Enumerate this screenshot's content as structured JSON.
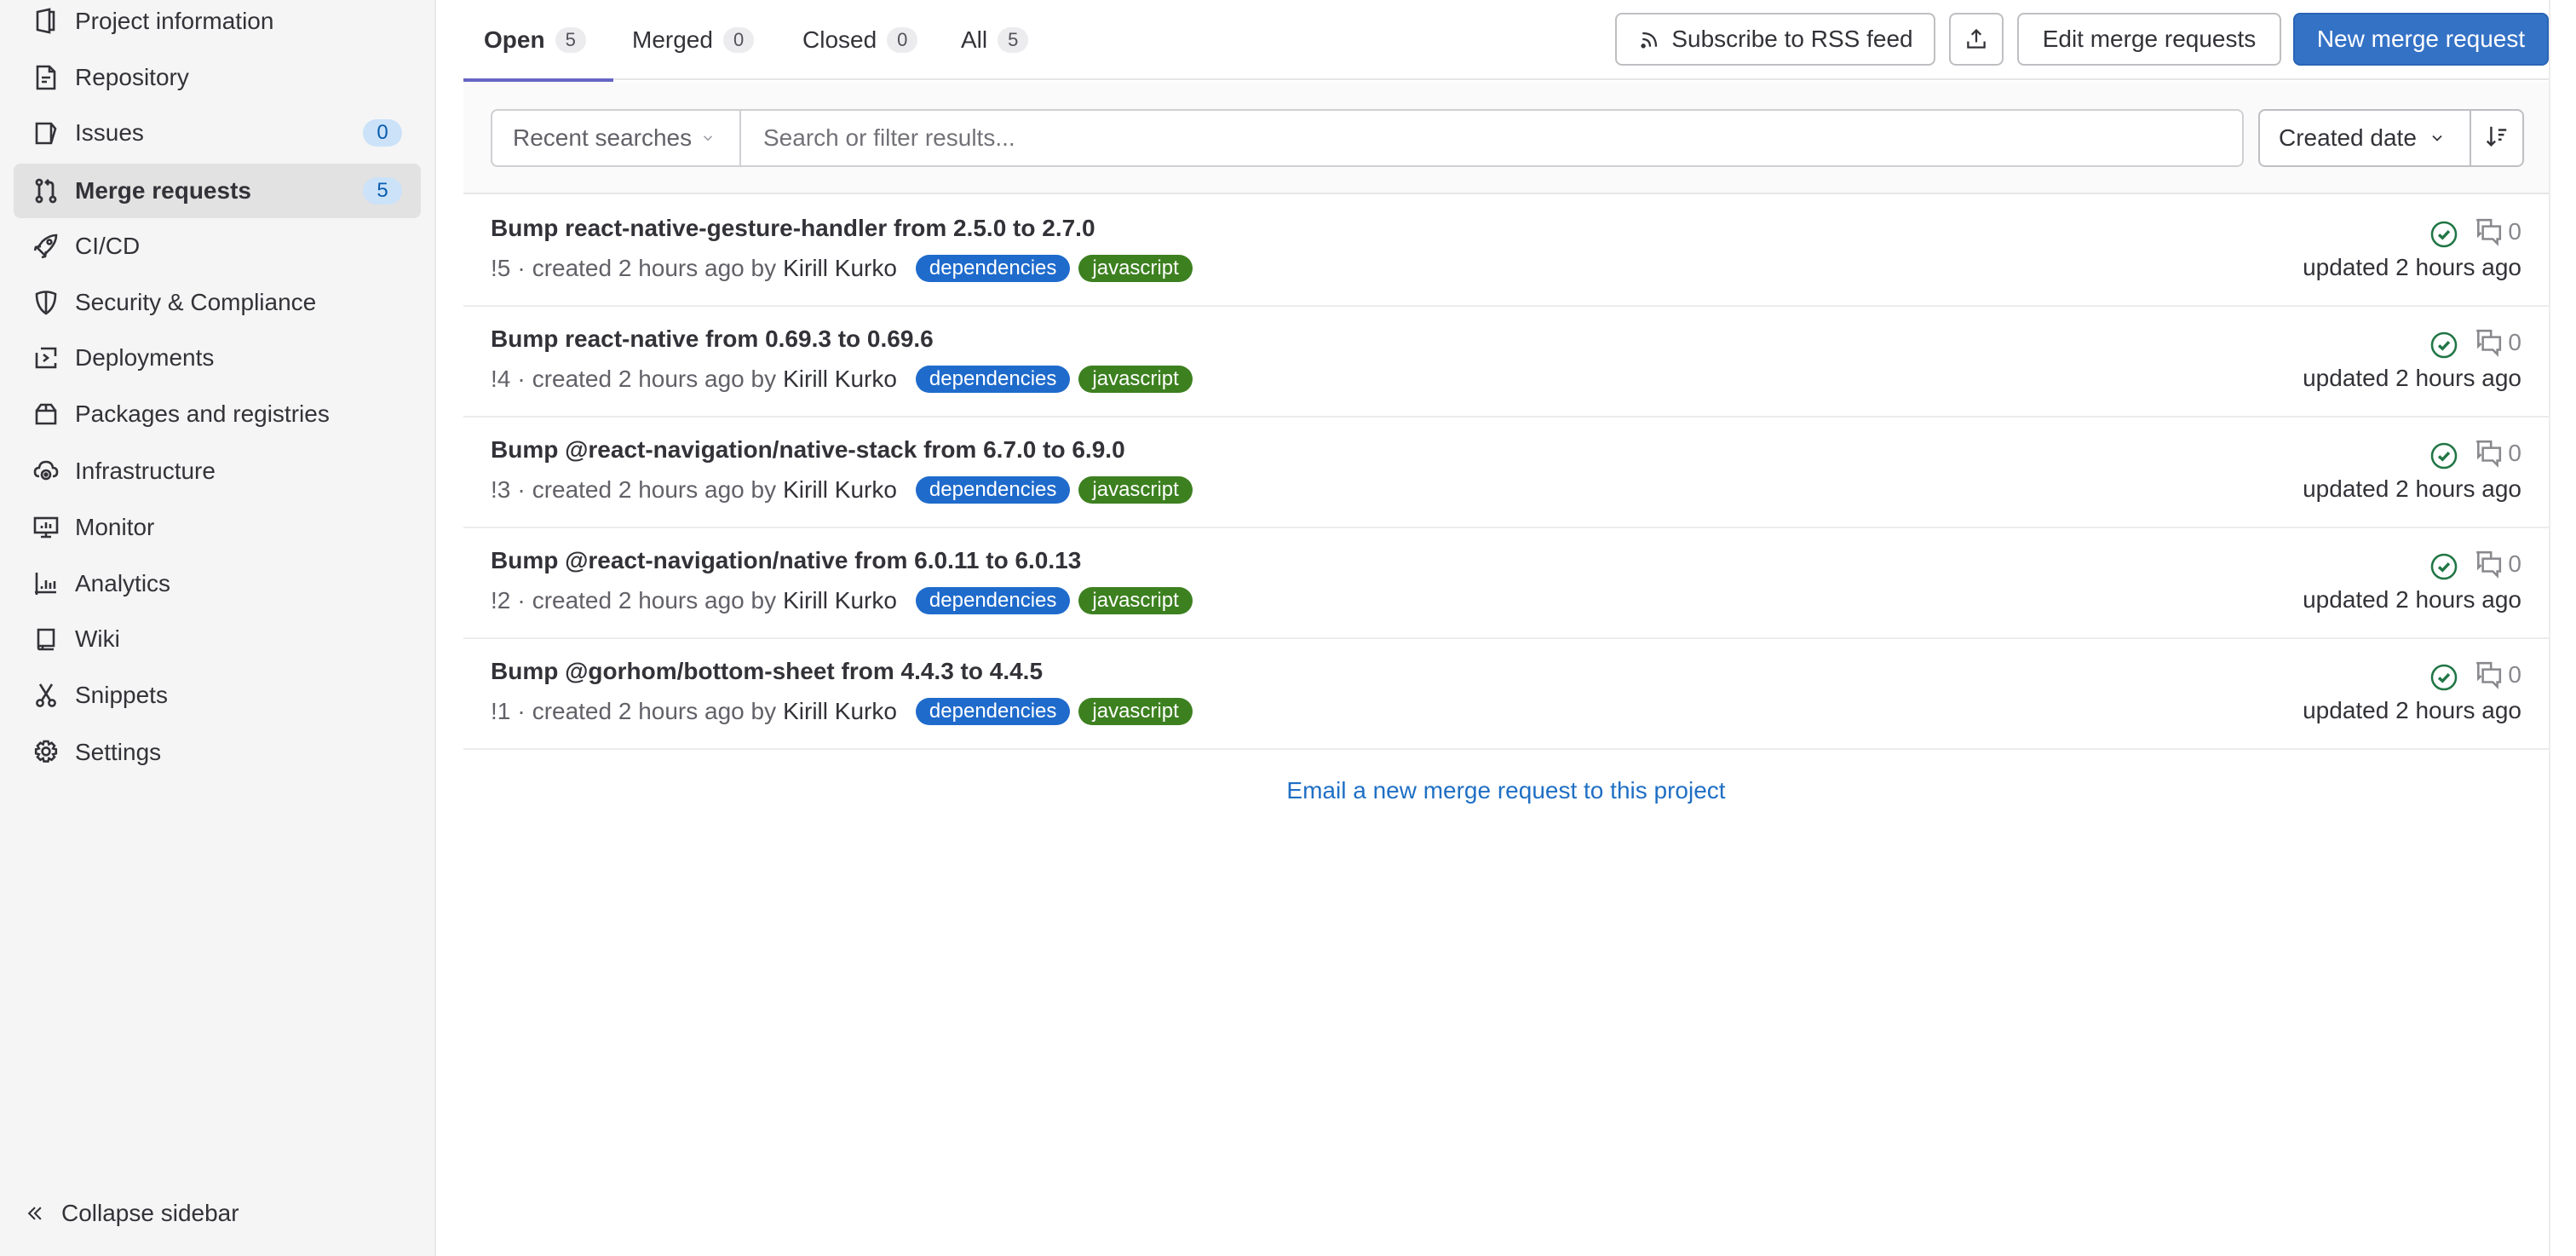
{
  "sidebar": {
    "items": [
      {
        "label": "Project information",
        "icon": "project-info-icon"
      },
      {
        "label": "Repository",
        "icon": "document-icon"
      },
      {
        "label": "Issues",
        "icon": "issues-icon",
        "count": "0"
      },
      {
        "label": "Merge requests",
        "icon": "merge-request-icon",
        "count": "5",
        "active": true
      },
      {
        "label": "CI/CD",
        "icon": "rocket-icon"
      },
      {
        "label": "Security & Compliance",
        "icon": "shield-icon"
      },
      {
        "label": "Deployments",
        "icon": "deployments-icon"
      },
      {
        "label": "Packages and registries",
        "icon": "package-icon"
      },
      {
        "label": "Infrastructure",
        "icon": "cloud-gear-icon"
      },
      {
        "label": "Monitor",
        "icon": "monitor-icon"
      },
      {
        "label": "Analytics",
        "icon": "chart-icon"
      },
      {
        "label": "Wiki",
        "icon": "book-icon"
      },
      {
        "label": "Snippets",
        "icon": "scissors-icon"
      },
      {
        "label": "Settings",
        "icon": "gear-icon"
      }
    ],
    "collapse_label": "Collapse sidebar"
  },
  "tabs": [
    {
      "label": "Open",
      "count": "5",
      "active": true
    },
    {
      "label": "Merged",
      "count": "0"
    },
    {
      "label": "Closed",
      "count": "0"
    },
    {
      "label": "All",
      "count": "5"
    }
  ],
  "toolbar": {
    "rss_label": "Subscribe to RSS feed",
    "export_icon": "export-icon",
    "edit_label": "Edit merge requests",
    "new_label": "New merge request"
  },
  "filter": {
    "recent_label": "Recent searches",
    "search_placeholder": "Search or filter results...",
    "search_value": "",
    "sort_label": "Created date",
    "sort_direction_icon": "sort-descending-icon"
  },
  "colors": {
    "primary": "#3472c6",
    "label_dependencies": "#1f6bcc",
    "label_javascript": "#3d8020",
    "ci_success": "#217645",
    "tab_active_underline": "#6666c4"
  },
  "merge_requests": [
    {
      "title": "Bump react-native-gesture-handler from 2.5.0 to 2.7.0",
      "ref": "!5",
      "created": "created 2 hours ago by",
      "author": "Kirill Kurko",
      "labels": [
        "dependencies",
        "javascript"
      ],
      "comments": "0",
      "updated": "updated 2 hours ago",
      "pipeline": "passed"
    },
    {
      "title": "Bump react-native from 0.69.3 to 0.69.6",
      "ref": "!4",
      "created": "created 2 hours ago by",
      "author": "Kirill Kurko",
      "labels": [
        "dependencies",
        "javascript"
      ],
      "comments": "0",
      "updated": "updated 2 hours ago",
      "pipeline": "passed"
    },
    {
      "title": "Bump @react-navigation/native-stack from 6.7.0 to 6.9.0",
      "ref": "!3",
      "created": "created 2 hours ago by",
      "author": "Kirill Kurko",
      "labels": [
        "dependencies",
        "javascript"
      ],
      "comments": "0",
      "updated": "updated 2 hours ago",
      "pipeline": "passed"
    },
    {
      "title": "Bump @react-navigation/native from 6.0.11 to 6.0.13",
      "ref": "!2",
      "created": "created 2 hours ago by",
      "author": "Kirill Kurko",
      "labels": [
        "dependencies",
        "javascript"
      ],
      "comments": "0",
      "updated": "updated 2 hours ago",
      "pipeline": "passed"
    },
    {
      "title": "Bump @gorhom/bottom-sheet from 4.4.3 to 4.4.5",
      "ref": "!1",
      "created": "created 2 hours ago by",
      "author": "Kirill Kurko",
      "labels": [
        "dependencies",
        "javascript"
      ],
      "comments": "0",
      "updated": "updated 2 hours ago",
      "pipeline": "passed"
    }
  ],
  "email_link": "Email a new merge request to this project"
}
